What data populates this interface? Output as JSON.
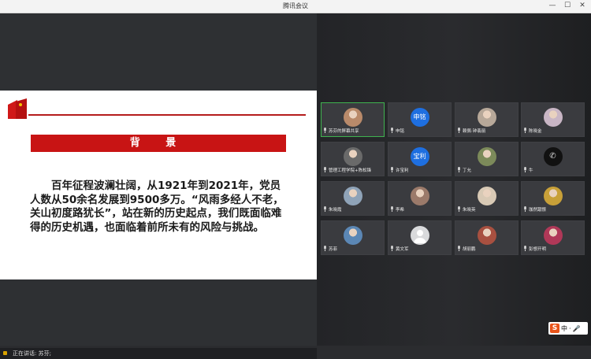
{
  "window": {
    "title": "腾讯会议"
  },
  "window_controls": {
    "minimize": "—",
    "maximize": "☐",
    "close": "✕"
  },
  "slide": {
    "heading": "背 景",
    "body": "百年征程波澜壮阔，从1921年到2021年，党员人数从50余名发展到9500多万。“风雨多经人不老，关山初度路犹长”，站在新的历史起点，我们既面临难得的历史机遇，也面临着前所未有的风险与挑战。"
  },
  "status": {
    "speaking": "正在讲话: 苏芬;"
  },
  "participants": [
    {
      "name": "苏芬的屏幕共享",
      "avatar": "photo",
      "color": "#b98a6a"
    },
    {
      "name": "申铭",
      "avatar": "text",
      "avatar_text": "申铭"
    },
    {
      "name": "赖佩·钟翡丽",
      "avatar": "photo",
      "color": "#b7a899"
    },
    {
      "name": "陈晓金",
      "avatar": "photo",
      "color": "#c9b6c5"
    },
    {
      "name": "管理工程学院+陈松锋",
      "avatar": "photo",
      "color": "#6a6a6a"
    },
    {
      "name": "许宝利",
      "avatar": "text",
      "avatar_text": "宝利"
    },
    {
      "name": "丁允",
      "avatar": "photo",
      "color": "#7c8a5a"
    },
    {
      "name": "牛",
      "avatar": "phone"
    },
    {
      "name": "朱晓霞",
      "avatar": "photo",
      "color": "#8fa3b8"
    },
    {
      "name": "李希",
      "avatar": "photo",
      "color": "#9b7a6a"
    },
    {
      "name": "朱晓英",
      "avatar": "photo",
      "color": "#d8c9b5"
    },
    {
      "name": "珈然蹴憬",
      "avatar": "photo",
      "color": "#c8a038"
    },
    {
      "name": "苏菲",
      "avatar": "photo",
      "color": "#5b87b5"
    },
    {
      "name": "黄文军",
      "avatar": "default"
    },
    {
      "name": "胡丽鹏",
      "avatar": "photo",
      "color": "#a85040"
    },
    {
      "name": "彭想开明",
      "avatar": "photo",
      "color": "#b03858"
    }
  ],
  "ime": {
    "logo": "S",
    "mode": "中",
    "punct": "·"
  },
  "colors": {
    "slide_red": "#c81414",
    "accent_green": "#3fb34f",
    "avatar_blue": "#1e6fe0"
  }
}
